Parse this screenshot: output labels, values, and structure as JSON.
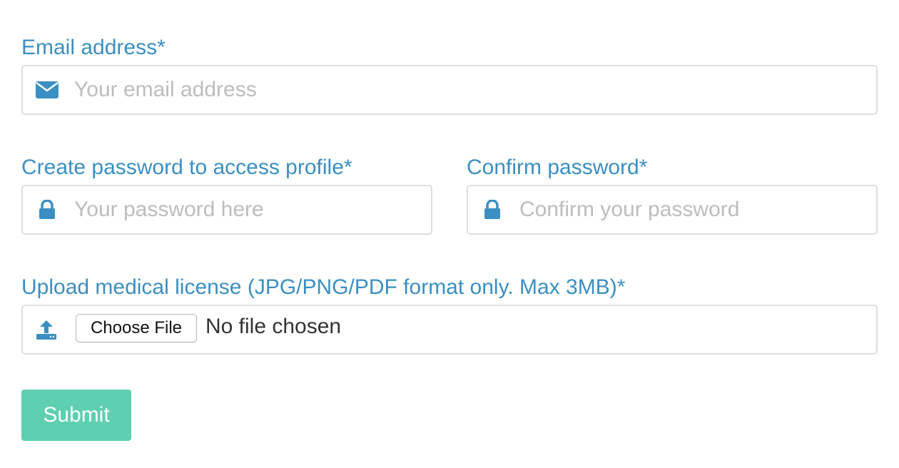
{
  "form": {
    "email": {
      "label": "Email address*",
      "placeholder": "Your email address",
      "value": "",
      "icon": "envelope-icon"
    },
    "password": {
      "label": "Create password to access profile*",
      "placeholder": "Your password here",
      "value": "",
      "icon": "lock-icon"
    },
    "confirm_password": {
      "label": "Confirm password*",
      "placeholder": "Confirm your password",
      "value": "",
      "icon": "lock-icon"
    },
    "license_upload": {
      "label": "Upload medical license (JPG/PNG/PDF format only. Max 3MB)*",
      "button_label": "Choose File",
      "status_text": "No file chosen",
      "icon": "upload-icon"
    },
    "submit_label": "Submit"
  },
  "colors": {
    "label": "#3b8fc2",
    "icon": "#3b8fc2",
    "placeholder": "#bdbdbd",
    "field_border": "#dedede",
    "submit_bg": "#5fcfb1",
    "submit_text": "#ffffff"
  }
}
